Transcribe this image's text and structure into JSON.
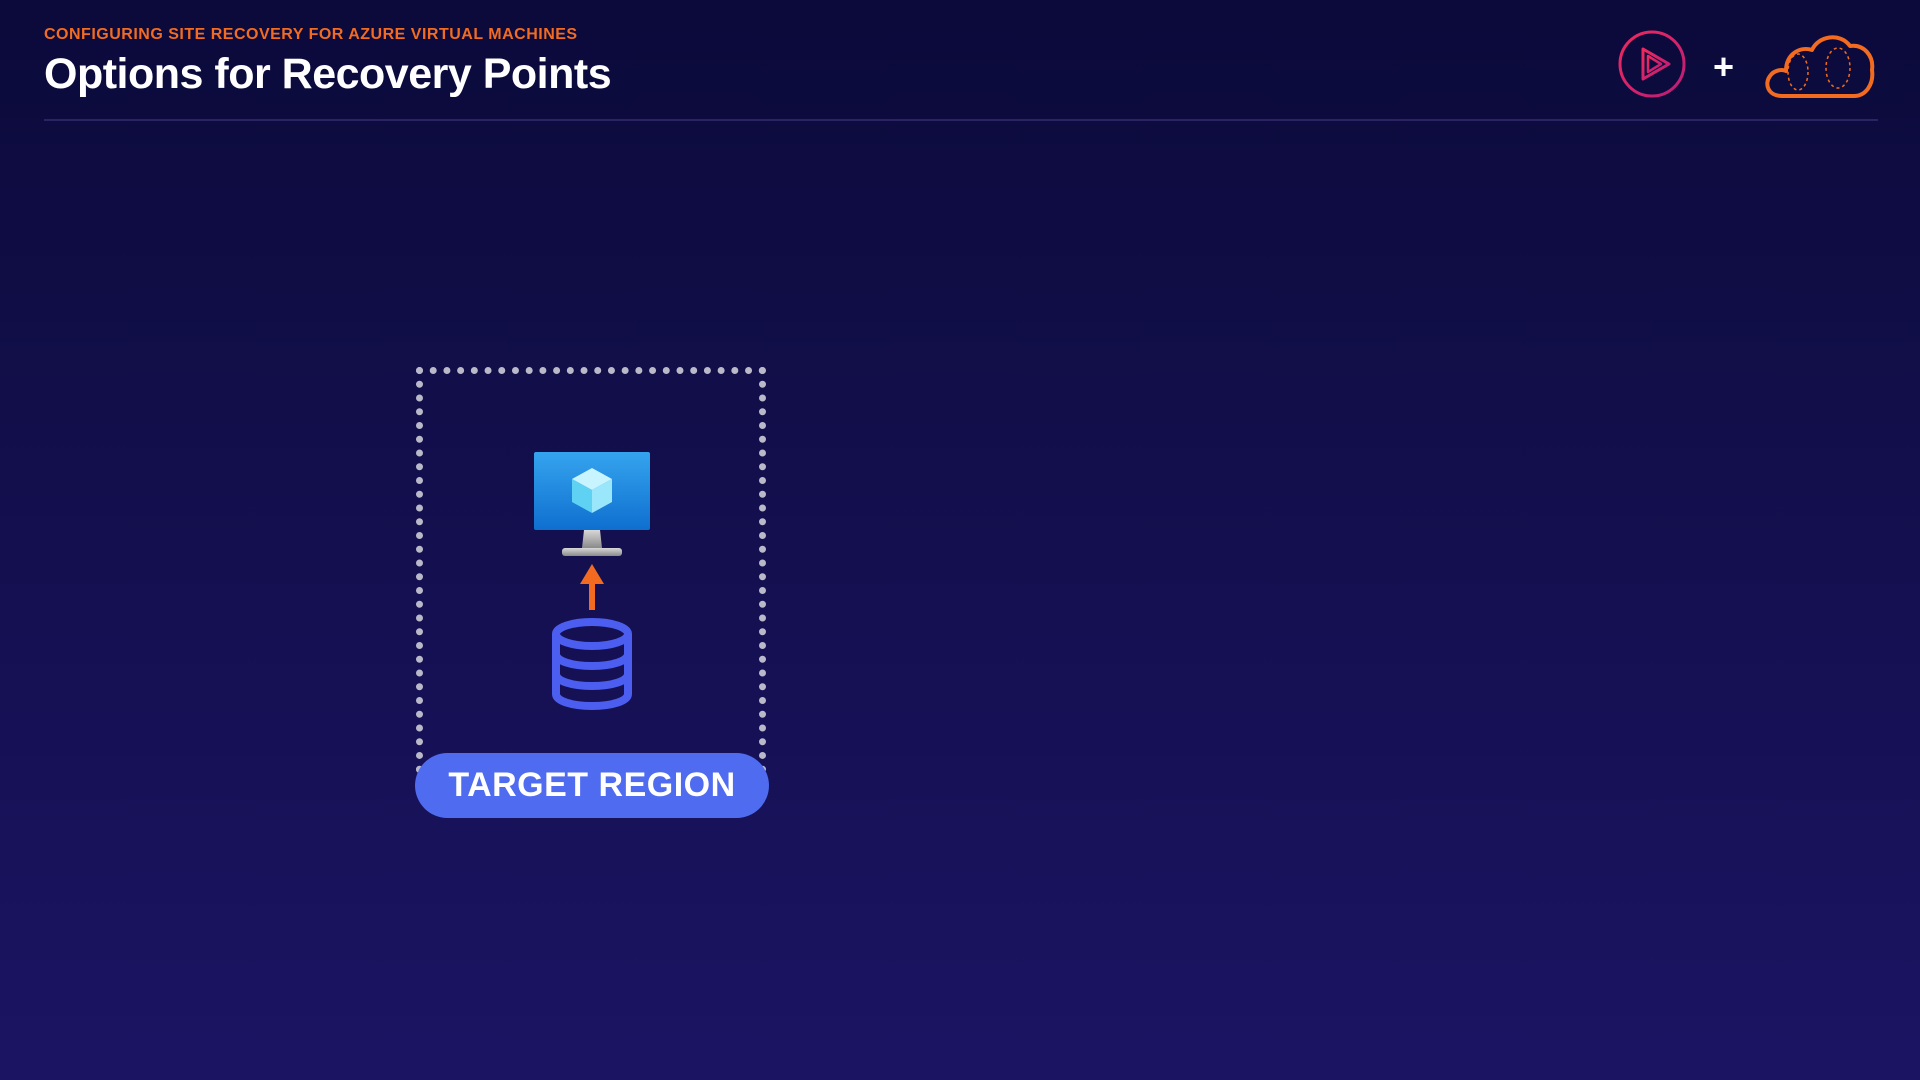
{
  "header": {
    "kicker": "CONFIGURING SITE RECOVERY FOR AZURE VIRTUAL MACHINES",
    "title": "Options for Recovery Points"
  },
  "logos": {
    "left_icon": "play-circle-icon",
    "separator": "+",
    "right_icon": "cloud-icon"
  },
  "diagram": {
    "region_label": "TARGET REGION",
    "vm_icon": "virtual-machine-icon",
    "arrow_icon": "up-arrow-icon",
    "storage_icon": "database-icon"
  },
  "colors": {
    "accent_orange": "#f26b21",
    "label_blue": "#4f6bf0",
    "database_blue": "#4b5ef0",
    "play_pink": "#e3265d"
  }
}
